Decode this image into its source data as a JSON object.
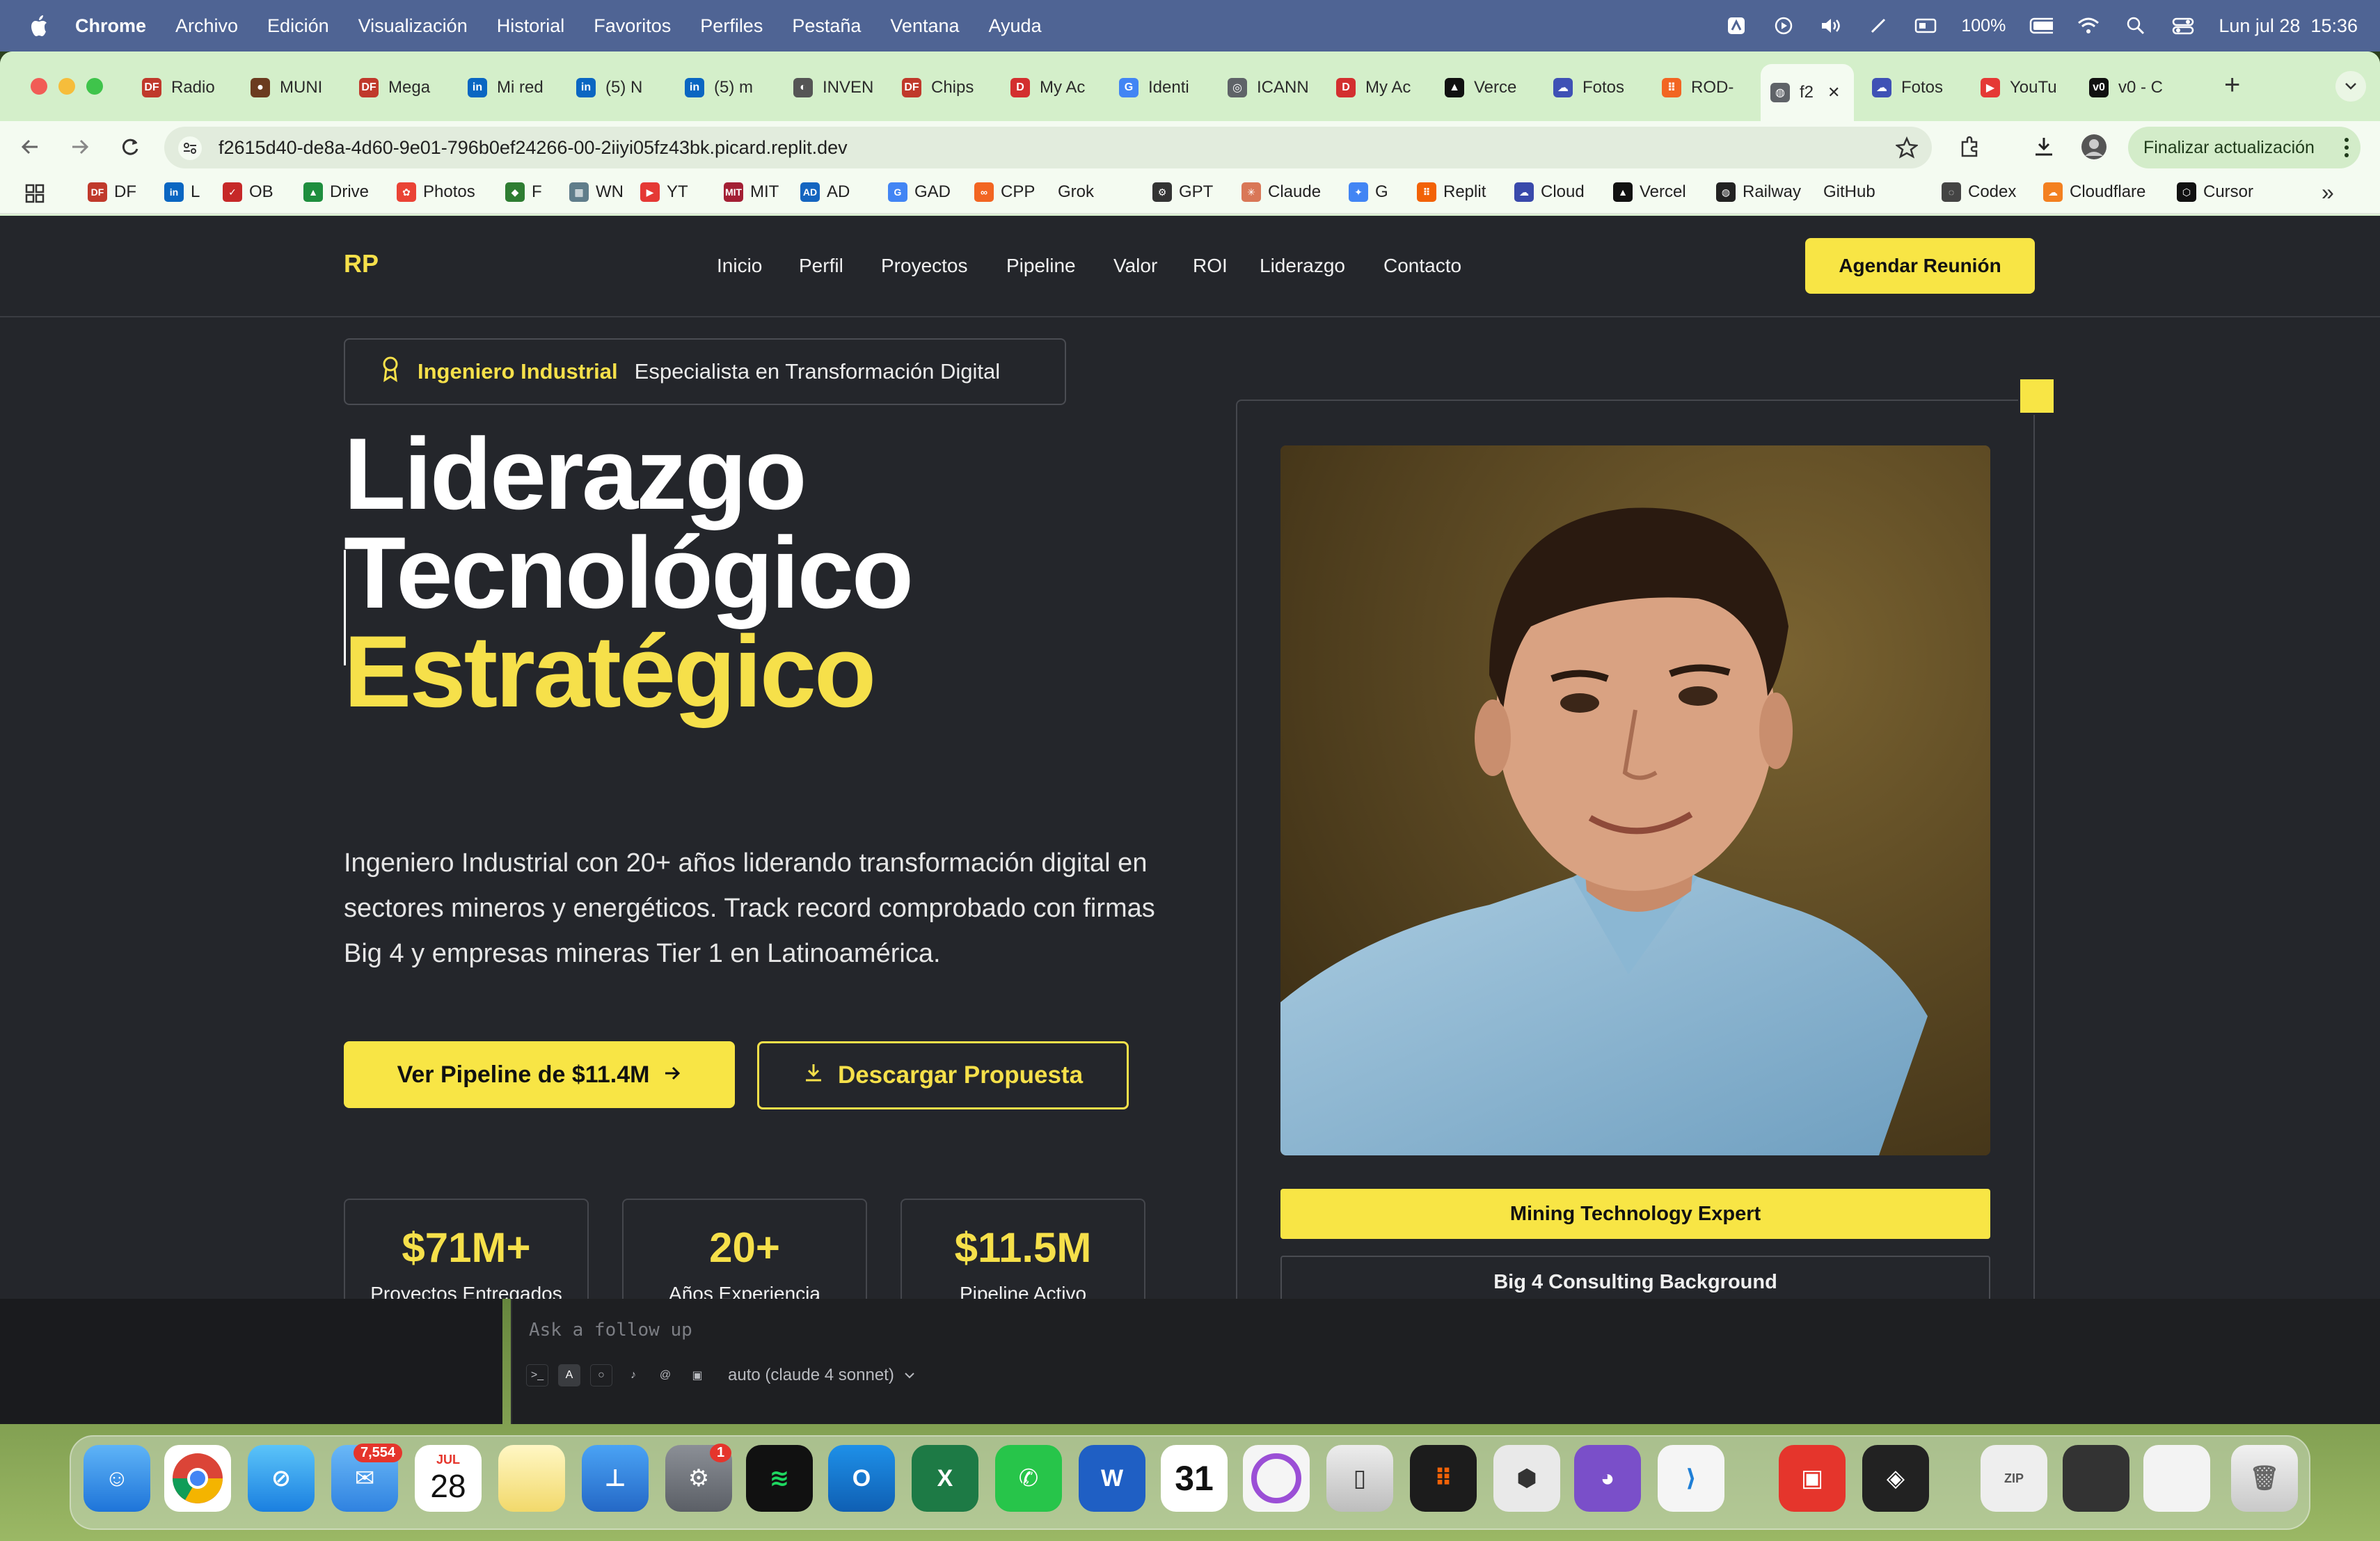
{
  "menubar": {
    "app": "Chrome",
    "items": [
      "Archivo",
      "Edición",
      "Visualización",
      "Historial",
      "Favoritos",
      "Perfiles",
      "Pestaña",
      "Ventana",
      "Ayuda"
    ],
    "battery": "100%",
    "datetime": "Lun jul 28  15:36"
  },
  "tabs": [
    {
      "label": "Radio",
      "color": "#c0392b",
      "glyph": "DF"
    },
    {
      "label": "MUNI",
      "color": "#6b3b1f",
      "glyph": "●"
    },
    {
      "label": "Mega",
      "color": "#c0392b",
      "glyph": "DF"
    },
    {
      "label": "Mi red",
      "color": "#0a66c2",
      "glyph": "in"
    },
    {
      "label": "(5) N",
      "color": "#0a66c2",
      "glyph": "in"
    },
    {
      "label": "(5) m",
      "color": "#0a66c2",
      "glyph": "in"
    },
    {
      "label": "INVEN",
      "color": "#555555",
      "glyph": "◐"
    },
    {
      "label": "Chips",
      "color": "#c0392b",
      "glyph": "DF"
    },
    {
      "label": "My Ac",
      "color": "#d32f2f",
      "glyph": "D"
    },
    {
      "label": "Identi",
      "color": "#4285f4",
      "glyph": "G"
    },
    {
      "label": "ICANN",
      "color": "#5f6368",
      "glyph": "◎"
    },
    {
      "label": "My Ac",
      "color": "#d32f2f",
      "glyph": "D"
    },
    {
      "label": "Verce",
      "color": "#111111",
      "glyph": "▲"
    },
    {
      "label": "Fotos",
      "color": "#3f51b5",
      "glyph": "☁"
    },
    {
      "label": "ROD-",
      "color": "#f26522",
      "glyph": "⠿"
    },
    {
      "label": "f2",
      "color": "#5f6368",
      "glyph": "◍",
      "active": true
    },
    {
      "label": "Fotos",
      "color": "#3f51b5",
      "glyph": "☁"
    },
    {
      "label": "YouTu",
      "color": "#e53935",
      "glyph": "▶"
    },
    {
      "label": "v0 - C",
      "color": "#111111",
      "glyph": "v0"
    }
  ],
  "url": "f2615d40-de8a-4d60-9e01-796b0ef24266-00-2iiyi05fz43bk.picard.replit.dev",
  "update_button": "Finalizar actualización",
  "bookmarks": [
    {
      "label": "DF",
      "color": "#c0392b",
      "glyph": "DF"
    },
    {
      "label": "L",
      "color": "#0a66c2",
      "glyph": "in"
    },
    {
      "label": "OB",
      "color": "#c62828",
      "glyph": "✓"
    },
    {
      "label": "Drive",
      "color": "#1e8e3e",
      "glyph": "▲"
    },
    {
      "label": "Photos",
      "color": "#ea4335",
      "glyph": "✿"
    },
    {
      "label": "F",
      "color": "#2e7d32",
      "glyph": "◆"
    },
    {
      "label": "WN",
      "color": "#607d8b",
      "glyph": "▦"
    },
    {
      "label": "YT",
      "color": "#e53935",
      "glyph": "▶"
    },
    {
      "label": "MIT",
      "color": "#a31f34",
      "glyph": "MIT"
    },
    {
      "label": "AD",
      "color": "#1565c0",
      "glyph": "AD"
    },
    {
      "label": "GAD",
      "color": "#4285f4",
      "glyph": "G"
    },
    {
      "label": "CPP",
      "color": "#f26522",
      "glyph": "∞"
    },
    {
      "label": "Grok",
      "color": "#f4fbf1",
      "glyph": ""
    },
    {
      "label": "GPT",
      "color": "#333333",
      "glyph": "⚙"
    },
    {
      "label": "Claude",
      "color": "#d97757",
      "glyph": "✳"
    },
    {
      "label": "G",
      "color": "#4285f4",
      "glyph": "✦"
    },
    {
      "label": "Replit",
      "color": "#f26207",
      "glyph": "⠿"
    },
    {
      "label": "Cloud",
      "color": "#3949ab",
      "glyph": "☁"
    },
    {
      "label": "Vercel",
      "color": "#111111",
      "glyph": "▲"
    },
    {
      "label": "Railway",
      "color": "#222222",
      "glyph": "◍"
    },
    {
      "label": "GitHub",
      "color": "#f4fbf1",
      "glyph": ""
    },
    {
      "label": "Codex",
      "color": "#444444",
      "glyph": "◌"
    },
    {
      "label": "Cloudflare",
      "color": "#f38020",
      "glyph": "☁"
    },
    {
      "label": "Cursor",
      "color": "#111111",
      "glyph": "⬡"
    }
  ],
  "site": {
    "logo": "RP",
    "nav": [
      "Inicio",
      "Perfil",
      "Proyectos",
      "Pipeline",
      "Valor",
      "ROI",
      "Liderazgo",
      "Contacto"
    ],
    "cta": "Agendar Reunión",
    "badge_title": "Ingeniero Industrial",
    "badge_sub": "Especialista en Transformación Digital",
    "title_line1": "Liderazgo",
    "title_line2": "Tecnológico",
    "title_line3": "Estratégico",
    "description": "Ingeniero Industrial con 20+ años liderando transformación digital en sectores mineros y energéticos. Track record comprobado con firmas Big 4 y empresas mineras Tier 1 en Latinoamérica.",
    "btn_primary": "Ver Pipeline de $11.4M",
    "btn_secondary": "Descargar Propuesta",
    "stats": [
      {
        "value": "$71M+",
        "label": "Proyectos Entregados"
      },
      {
        "value": "20+",
        "label": "Años Experiencia"
      },
      {
        "value": "$11.5M",
        "label": "Pipeline Activo"
      }
    ],
    "tag_primary": "Mining Technology Expert",
    "tag_secondary": "Big 4 Consulting Background",
    "accent": "#f8e545"
  },
  "followup": {
    "placeholder": "Ask a follow up",
    "model": "auto (claude 4 sonnet)"
  },
  "dock": {
    "mail_badge": "7,554",
    "calendar_month": "JUL",
    "calendar_day": "28",
    "settings_badge": "1",
    "calendar2_day": "31"
  }
}
